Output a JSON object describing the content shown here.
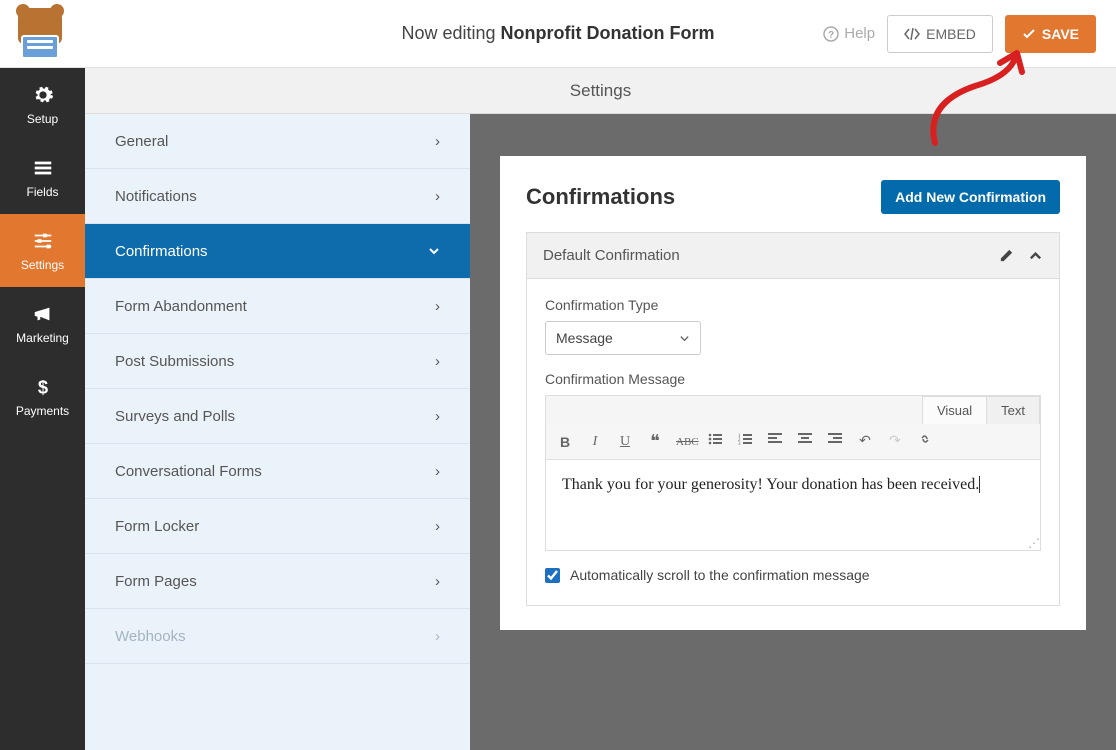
{
  "header": {
    "editing_prefix": "Now editing ",
    "form_name": "Nonprofit Donation Form",
    "help_label": "Help",
    "embed_label": "EMBED",
    "save_label": "SAVE"
  },
  "leftbar": {
    "items": [
      {
        "label": "Setup"
      },
      {
        "label": "Fields"
      },
      {
        "label": "Settings"
      },
      {
        "label": "Marketing"
      },
      {
        "label": "Payments"
      }
    ]
  },
  "tabrow": {
    "title": "Settings"
  },
  "subnav": {
    "items": [
      {
        "label": "General"
      },
      {
        "label": "Notifications"
      },
      {
        "label": "Confirmations"
      },
      {
        "label": "Form Abandonment"
      },
      {
        "label": "Post Submissions"
      },
      {
        "label": "Surveys and Polls"
      },
      {
        "label": "Conversational Forms"
      },
      {
        "label": "Form Locker"
      },
      {
        "label": "Form Pages"
      },
      {
        "label": "Webhooks"
      }
    ]
  },
  "card": {
    "title": "Confirmations",
    "add_button": "Add New Confirmation"
  },
  "confirmation": {
    "header": "Default Confirmation",
    "type_label": "Confirmation Type",
    "type_value": "Message",
    "message_label": "Confirmation Message",
    "editor_tabs": {
      "visual": "Visual",
      "text": "Text"
    },
    "message_text": "Thank you for your generosity! Your donation has been received.",
    "autoscroll_label": "Automatically scroll to the confirmation message"
  }
}
